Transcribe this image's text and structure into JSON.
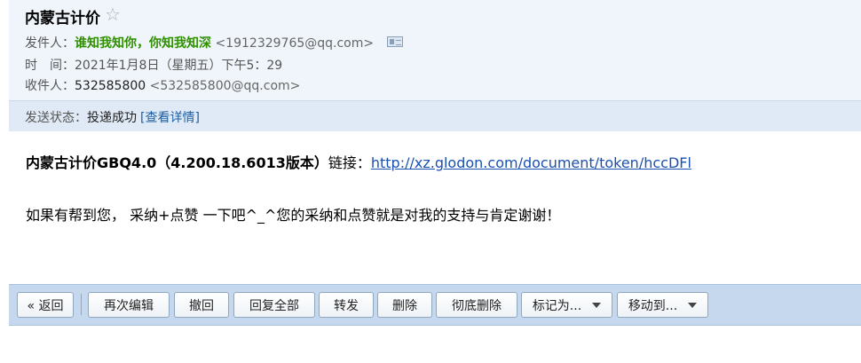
{
  "header": {
    "subject": "内蒙古计价",
    "star_icon": "☆",
    "sender_label": "发件人：",
    "sender_name": "谁知我知你，你知我知深",
    "sender_email": "<1912329765@qq.com>",
    "time_label": "时　间：",
    "time_value": "2021年1月8日（星期五）下午5：29",
    "recipient_label": "收件人：",
    "recipient_name": "532585800",
    "recipient_email": "<532585800@qq.com>",
    "status_label": "发送状态：",
    "status_value": "投递成功",
    "status_detail": "[查看详情]"
  },
  "body": {
    "title_bold": "内蒙古计价GBQ4.0（4.200.18.6013版本）",
    "link_label": "链接：",
    "link_url": "http://xz.glodon.com/document/token/hccDFl",
    "message": "如果有帮到您， 采纳+点赞 一下吧^_^您的采纳和点赞就是对我的支持与肯定谢谢！"
  },
  "toolbar": {
    "back": "« 返回",
    "edit_again": "再次编辑",
    "recall": "撤回",
    "reply_all": "回复全部",
    "forward": "转发",
    "delete": "删除",
    "delete_permanent": "彻底删除",
    "mark_as": "标记为...",
    "move_to": "移动到..."
  }
}
